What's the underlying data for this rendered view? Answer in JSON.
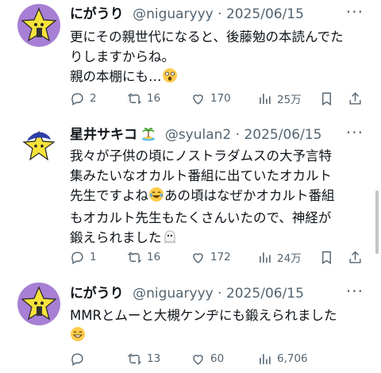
{
  "posts": [
    {
      "name": "にがうり",
      "handle": "@niguaryyy",
      "date": "2025/06/15",
      "text_lines": [
        "更にその親世代になると、後藤勉の本読んでた",
        "りしますからね。",
        "親の本棚にも…"
      ],
      "emoji_end": "shocked-face",
      "stats": {
        "replies": "2",
        "reposts": "16",
        "likes": "170",
        "views": "25万"
      }
    },
    {
      "name": "星井サキコ",
      "name_emoji": "island-icon",
      "handle": "@syulan2",
      "date": "2025/06/15",
      "text_lines": [
        "我々が子供の頃にノストラダムスの大予言特",
        "集みたいなオカルト番組に出ていたオカルト",
        "先生ですよね",
        "あの頃はなぜかオカルト番組",
        "もオカルト先生もたくさんいたので、神経が",
        "鍛えられました"
      ],
      "stats": {
        "replies": "1",
        "reposts": "16",
        "likes": "172",
        "views": "24万"
      }
    },
    {
      "name": "にがうり",
      "handle": "@niguaryyy",
      "date": "2025/06/15",
      "text_lines": [
        "MMRとムーと大槻ケンヂにも鍛えられました"
      ],
      "stats": {
        "replies": "",
        "reposts": "13",
        "likes": "60",
        "views": "6,706"
      }
    }
  ],
  "separator": "·",
  "colors": {
    "text": "#0f1419",
    "muted": "#536471",
    "avatar_purple": "#a77fd4",
    "star_yellow": "#f7e23a"
  }
}
